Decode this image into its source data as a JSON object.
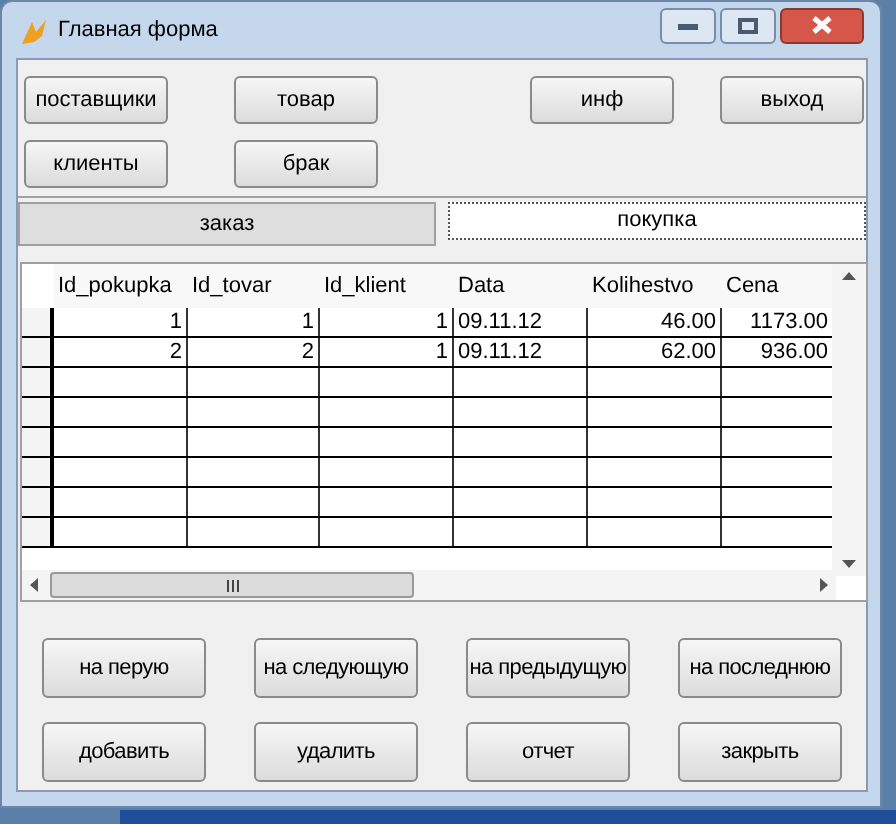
{
  "window": {
    "title": "Главная форма"
  },
  "top_buttons": [
    [
      "поставщики",
      "товар",
      "инф",
      "выход"
    ],
    [
      "клиенты",
      "брак"
    ]
  ],
  "tabs": [
    {
      "label": "заказ",
      "selected": false
    },
    {
      "label": "покупка",
      "selected": true
    }
  ],
  "table": {
    "columns": [
      "Id_pokupka",
      "Id_tovar",
      "Id_klient",
      "Data",
      "Kolihestvo",
      "Cena"
    ],
    "rows": [
      [
        "1",
        "1",
        "1",
        "09.11.12",
        "46.00",
        "1173.00"
      ],
      [
        "2",
        "2",
        "1",
        "09.11.12",
        "62.00",
        "936.00"
      ]
    ]
  },
  "nav_buttons": [
    "на перую",
    "на следующую",
    "на предыдущую",
    "на последнюю"
  ],
  "action_buttons": [
    "добавить",
    "удалить",
    "отчет",
    "закрыть"
  ]
}
